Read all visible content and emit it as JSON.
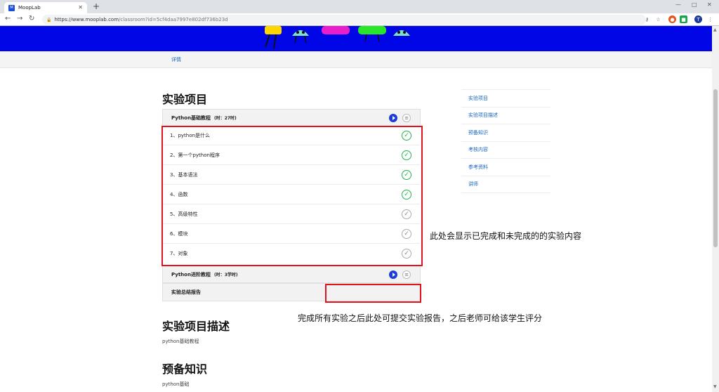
{
  "browser": {
    "tab_title": "MoopLab",
    "favicon_text": "M",
    "url_host": "https://www.mooplab.com",
    "url_path": "/classroom?id=5cf4daa7997e802df736b23d"
  },
  "subnav": {
    "detail_link": "详情"
  },
  "main": {
    "projects_title": "实验项目",
    "courses": [
      {
        "name": "Python基础教程",
        "hours": "(时：27时)",
        "lessons": [
          {
            "label": "1、python是什么",
            "done": true
          },
          {
            "label": "2、第一个python程序",
            "done": true
          },
          {
            "label": "3、基本语法",
            "done": true
          },
          {
            "label": "4、函数",
            "done": true
          },
          {
            "label": "5、高级特性",
            "done": false
          },
          {
            "label": "6、模块",
            "done": false
          },
          {
            "label": "7、对象",
            "done": false
          }
        ]
      },
      {
        "name": "Python进阶教程",
        "hours": "(时：3学时)"
      }
    ],
    "report_label": "实验总结报告",
    "description_title": "实验项目描述",
    "description_text": "python基础教程",
    "prereq_title": "预备知识",
    "prereq_text": "python基础"
  },
  "annotations": {
    "progress_note": "此处会显示已完成和未完成的的实验内容",
    "report_note": "完成所有实验之后此处可提交实验报告，之后老师可给该学生评分"
  },
  "sidenav": {
    "items": [
      "实验项目",
      "实验项目描述",
      "预备知识",
      "考核内容",
      "参考资料",
      "讲师"
    ]
  },
  "colors": {
    "banner": "#0006e6",
    "accent_link": "#1565c0",
    "done_green": "#22b24c",
    "highlight_red": "#e0141e"
  },
  "icons": {
    "done": "✓",
    "pending": "✓",
    "menu": "≡"
  }
}
